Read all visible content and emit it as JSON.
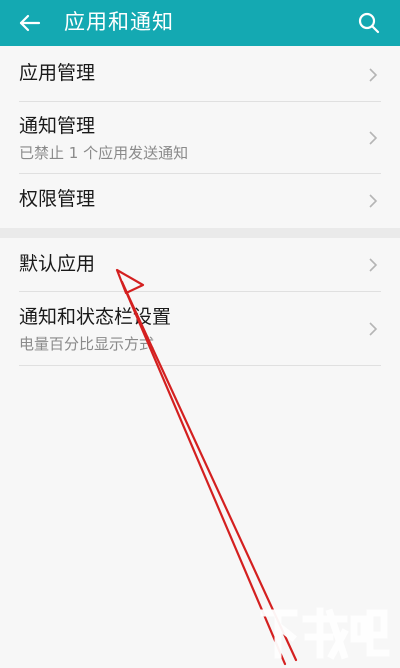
{
  "header": {
    "title": "应用和通知",
    "back_icon": "arrow-left-icon",
    "search_icon": "search-icon",
    "background": "#14a9b2"
  },
  "sections": [
    {
      "items": [
        {
          "title": "应用管理"
        },
        {
          "title": "通知管理",
          "subtitle": "已禁止 1 个应用发送通知"
        },
        {
          "title": "权限管理"
        }
      ]
    },
    {
      "items": [
        {
          "title": "默认应用"
        },
        {
          "title": "通知和状态栏设置",
          "subtitle": "电量百分比显示方式"
        }
      ]
    }
  ],
  "annotation": {
    "type": "red-arrow",
    "color": "#d42020"
  },
  "watermark": {
    "text": "下载吧"
  }
}
